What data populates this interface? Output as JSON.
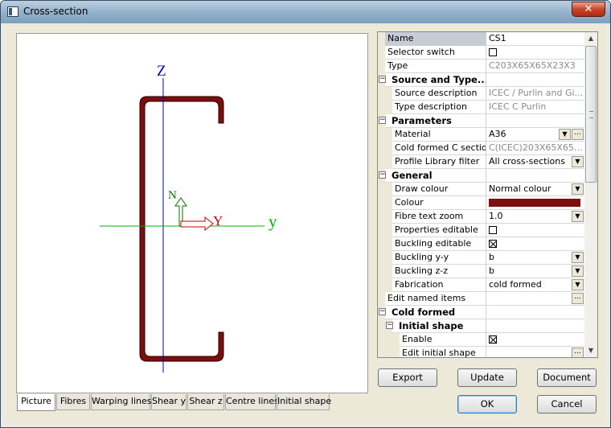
{
  "window": {
    "title": "Cross-section",
    "close_glyph": "✕"
  },
  "picture": {
    "z_label": "Z",
    "y_label": "y",
    "n_label": "N",
    "Y_label": "Y",
    "colors": {
      "z_axis": "#0000cc",
      "y_axis": "#00b000",
      "n_arrow": "#007700",
      "Y_arrow": "#cc0000",
      "section_fill": "#7b0e0e"
    }
  },
  "tabs": [
    "Picture",
    "Fibres",
    "Warping lines",
    "Shear y",
    "Shear z",
    "Centre lines",
    "Initial shape"
  ],
  "active_tab": "Picture",
  "properties": [
    {
      "name": "Name",
      "value": "CS1",
      "type": "text",
      "indent": 0
    },
    {
      "name": "Selector switch",
      "type": "check",
      "checked": false,
      "indent": 0
    },
    {
      "name": "Type",
      "value": "C203X65X65X23X3",
      "type": "text",
      "gray": true,
      "indent": 0
    },
    {
      "name": "Source and Type...",
      "type": "section",
      "indent": 0
    },
    {
      "name": "Source description",
      "value": "ICEC / Purlin and Girt...",
      "type": "text",
      "gray": true,
      "indent": 1
    },
    {
      "name": "Type description",
      "value": "ICEC C Purlin",
      "type": "text",
      "gray": true,
      "indent": 1
    },
    {
      "name": "Parameters",
      "type": "section",
      "indent": 0
    },
    {
      "name": "Material",
      "value": "A36",
      "type": "combo-dots",
      "indent": 1
    },
    {
      "name": "Cold formed C sections",
      "value": "C(ICEC)203X65X65X...",
      "type": "text",
      "gray": true,
      "indent": 1
    },
    {
      "name": "Profile Library filter",
      "value": "All cross-sections",
      "type": "combo",
      "indent": 1
    },
    {
      "name": "General",
      "type": "section",
      "indent": 0
    },
    {
      "name": "Draw colour",
      "value": "Normal colour",
      "type": "combo",
      "indent": 1
    },
    {
      "name": "Colour",
      "type": "colour",
      "indent": 1
    },
    {
      "name": "Fibre text zoom",
      "value": "1.0",
      "type": "combo",
      "indent": 1
    },
    {
      "name": "Properties editable",
      "type": "check",
      "checked": false,
      "indent": 1
    },
    {
      "name": "Buckling editable",
      "type": "check",
      "checked": true,
      "indent": 1
    },
    {
      "name": "Buckling y-y",
      "value": "b",
      "type": "combo",
      "indent": 1
    },
    {
      "name": "Buckling z-z",
      "value": "b",
      "type": "combo",
      "indent": 1
    },
    {
      "name": "Fabrication",
      "value": "cold formed",
      "type": "combo",
      "indent": 1
    },
    {
      "name": "Edit named items",
      "type": "dots",
      "indent": 0
    },
    {
      "name": "Cold formed",
      "type": "section",
      "indent": 0
    },
    {
      "name": "Initial shape",
      "type": "section",
      "indent": 1
    },
    {
      "name": "Enable",
      "type": "check",
      "checked": true,
      "indent": 2
    },
    {
      "name": "Edit initial shape",
      "type": "dots",
      "indent": 2
    }
  ],
  "scrollbar": {
    "up_glyph": "▲",
    "down_glyph": "▼"
  },
  "buttons": {
    "export": "Export",
    "update": "Update",
    "document": "Document",
    "ok": "OK",
    "cancel": "Cancel"
  }
}
